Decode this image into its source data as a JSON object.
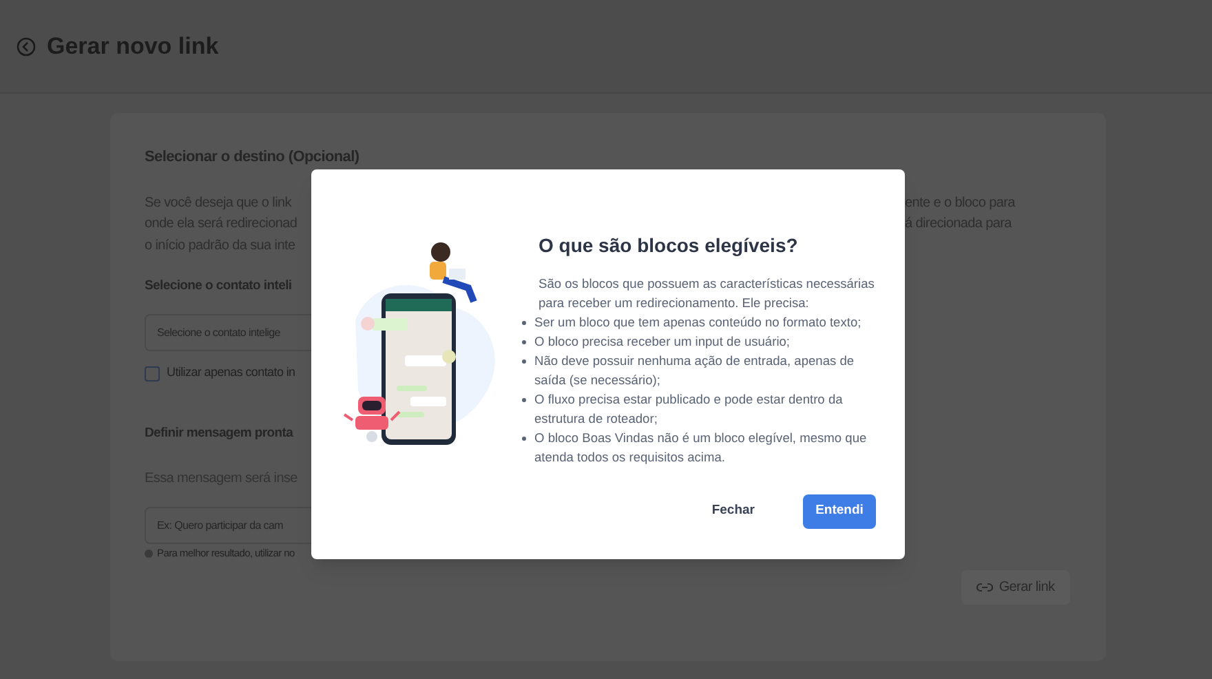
{
  "header": {
    "title": "Gerar novo link"
  },
  "form": {
    "section_title": "Selecionar o destino (Opcional)",
    "description_left": [
      "Se você deseja que o link",
      "onde ela será redirecionad",
      "o início padrão da sua inte"
    ],
    "description_right": [
      "ente e o bloco para",
      "á direcionada para"
    ],
    "contact_label": "Selecione o contato inteli",
    "contact_select": {
      "placeholder": "Selecione o contato intelige"
    },
    "checkbox": {
      "label": "Utilizar apenas contato in",
      "checked": false
    },
    "message_label": "Definir mensagem pronta",
    "message_description": "Essa mensagem será inse",
    "message_field": {
      "placeholder": "Ex: Quero participar da cam"
    },
    "hint": "Para melhor resultado, utilizar no",
    "generate_button": "Gerar link"
  },
  "modal": {
    "title": "O que são blocos elegíveis?",
    "intro": "São os blocos que possuem as características necessárias para receber um redirecionamento. Ele precisa:",
    "requirements": [
      "Ser um bloco que tem apenas conteúdo no formato texto;",
      "O bloco precisa receber um input de usuário;",
      "Não deve possuir nenhuma ação de entrada, apenas de saída (se necessário);",
      "O fluxo precisa estar publicado e pode estar dentro da estrutura de roteador;",
      "O bloco Boas Vindas não é um bloco elegível, mesmo que atenda todos os requisitos acima."
    ],
    "buttons": [
      {
        "label": "Fechar",
        "kind": "text"
      },
      {
        "label": "Entendi",
        "kind": "primary"
      }
    ]
  }
}
